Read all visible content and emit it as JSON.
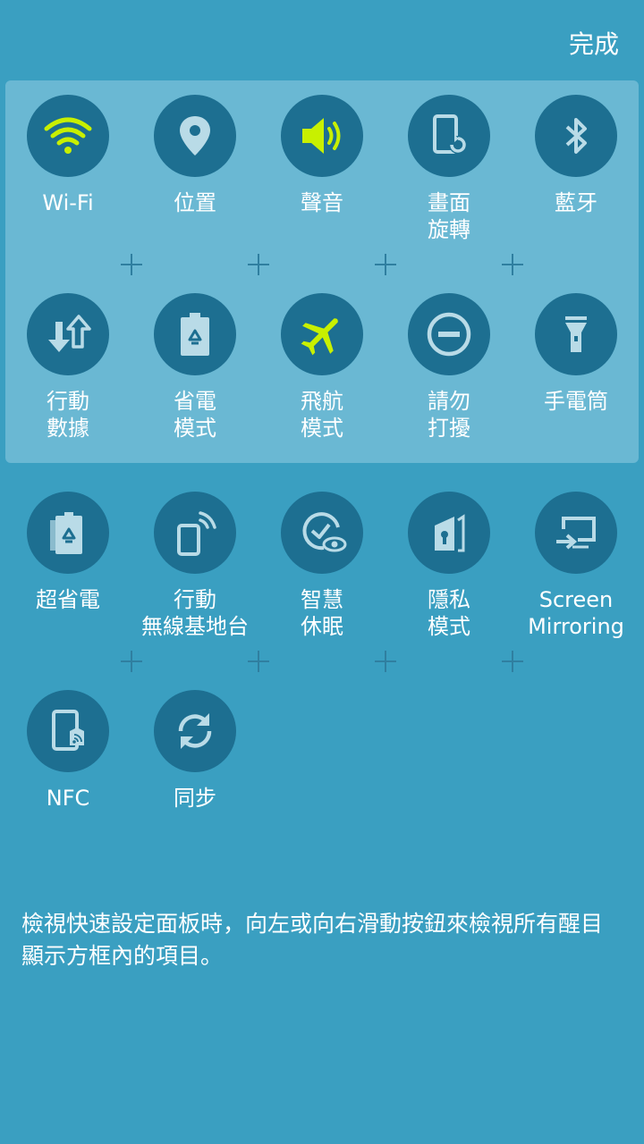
{
  "header": {
    "done_label": "完成"
  },
  "colors": {
    "active": "#c8f000",
    "icon": "#b9dbe7",
    "circle": "#1d6f91"
  },
  "row1": [
    {
      "line1": "Wi-Fi",
      "line2": "",
      "icon": "wifi-icon"
    },
    {
      "line1": "位置",
      "line2": "",
      "icon": "location-icon"
    },
    {
      "line1": "聲音",
      "line2": "",
      "icon": "sound-icon"
    },
    {
      "line1": "畫面",
      "line2": "旋轉",
      "icon": "screen-rotation-icon"
    },
    {
      "line1": "藍牙",
      "line2": "",
      "icon": "bluetooth-icon"
    }
  ],
  "row2": [
    {
      "line1": "行動",
      "line2": "數據",
      "icon": "mobile-data-icon"
    },
    {
      "line1": "省電",
      "line2": "模式",
      "icon": "power-saving-icon"
    },
    {
      "line1": "飛航",
      "line2": "模式",
      "icon": "airplane-icon"
    },
    {
      "line1": "請勿",
      "line2": "打擾",
      "icon": "do-not-disturb-icon"
    },
    {
      "line1": "手電筒",
      "line2": "",
      "icon": "flashlight-icon"
    }
  ],
  "row3": [
    {
      "line1": "超省電",
      "line2": "",
      "icon": "ultra-power-saving-icon"
    },
    {
      "line1": "行動",
      "line2": "無線基地台",
      "icon": "mobile-hotspot-icon"
    },
    {
      "line1": "智慧",
      "line2": "休眠",
      "icon": "smart-stay-icon"
    },
    {
      "line1": "隱私",
      "line2": "模式",
      "icon": "private-mode-icon"
    },
    {
      "line1": "Screen",
      "line2": "Mirroring",
      "icon": "screen-mirroring-icon"
    }
  ],
  "row4": [
    {
      "line1": "NFC",
      "line2": "",
      "icon": "nfc-icon"
    },
    {
      "line1": "同步",
      "line2": "",
      "icon": "sync-icon"
    }
  ],
  "hint_text": "檢視快速設定面板時，向左或向右滑動按鈕來檢視所有醒目顯示方框內的項目。"
}
